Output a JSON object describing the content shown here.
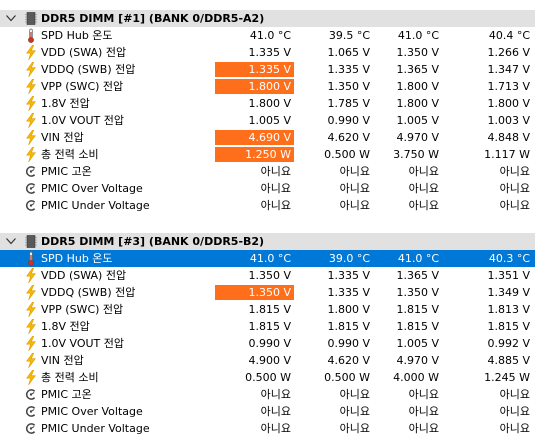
{
  "sections": [
    {
      "title": "DDR5 DIMM [#1] (BANK 0/DDR5-A2)",
      "rows": [
        {
          "icon": "thermometer-icon",
          "label": "SPD Hub 온도",
          "values": [
            "41.0 °C",
            "39.5 °C",
            "41.0 °C",
            "40.4 °C"
          ],
          "hl": []
        },
        {
          "icon": "lightning-icon",
          "label": "VDD (SWA) 전압",
          "values": [
            "1.335 V",
            "1.065 V",
            "1.350 V",
            "1.266 V"
          ],
          "hl": []
        },
        {
          "icon": "lightning-icon",
          "label": "VDDQ (SWB) 전압",
          "values": [
            "1.335 V",
            "1.335 V",
            "1.365 V",
            "1.347 V"
          ],
          "hl": [
            0
          ]
        },
        {
          "icon": "lightning-icon",
          "label": "VPP (SWC) 전압",
          "values": [
            "1.800 V",
            "1.350 V",
            "1.800 V",
            "1.713 V"
          ],
          "hl": [
            0
          ]
        },
        {
          "icon": "lightning-icon",
          "label": "1.8V 전압",
          "values": [
            "1.800 V",
            "1.785 V",
            "1.800 V",
            "1.800 V"
          ],
          "hl": []
        },
        {
          "icon": "lightning-icon",
          "label": "1.0V VOUT 전압",
          "values": [
            "1.005 V",
            "0.990 V",
            "1.005 V",
            "1.003 V"
          ],
          "hl": []
        },
        {
          "icon": "lightning-icon",
          "label": "VIN 전압",
          "values": [
            "4.690 V",
            "4.620 V",
            "4.970 V",
            "4.848 V"
          ],
          "hl": [
            0
          ]
        },
        {
          "icon": "lightning-icon",
          "label": "총 전력 소비",
          "values": [
            "1.250 W",
            "0.500 W",
            "3.750 W",
            "1.117 W"
          ],
          "hl": [
            0
          ]
        },
        {
          "icon": "status-icon",
          "label": "PMIC 고온",
          "values": [
            "아니요",
            "아니요",
            "아니요",
            "아니요"
          ],
          "hl": []
        },
        {
          "icon": "status-icon",
          "label": "PMIC Over Voltage",
          "values": [
            "아니요",
            "아니요",
            "아니요",
            "아니요"
          ],
          "hl": []
        },
        {
          "icon": "status-icon",
          "label": "PMIC Under Voltage",
          "values": [
            "아니요",
            "아니요",
            "아니요",
            "아니요"
          ],
          "hl": []
        }
      ]
    },
    {
      "title": "DDR5 DIMM [#3] (BANK 0/DDR5-B2)",
      "rows": [
        {
          "icon": "thermometer-icon",
          "label": "SPD Hub 온도",
          "values": [
            "41.0 °C",
            "39.0 °C",
            "41.0 °C",
            "40.3 °C"
          ],
          "hl": [],
          "selected": true
        },
        {
          "icon": "lightning-icon",
          "label": "VDD (SWA) 전압",
          "values": [
            "1.350 V",
            "1.335 V",
            "1.365 V",
            "1.351 V"
          ],
          "hl": []
        },
        {
          "icon": "lightning-icon",
          "label": "VDDQ (SWB) 전압",
          "values": [
            "1.350 V",
            "1.335 V",
            "1.350 V",
            "1.349 V"
          ],
          "hl": [
            0
          ]
        },
        {
          "icon": "lightning-icon",
          "label": "VPP (SWC) 전압",
          "values": [
            "1.815 V",
            "1.800 V",
            "1.815 V",
            "1.813 V"
          ],
          "hl": []
        },
        {
          "icon": "lightning-icon",
          "label": "1.8V 전압",
          "values": [
            "1.815 V",
            "1.815 V",
            "1.815 V",
            "1.815 V"
          ],
          "hl": []
        },
        {
          "icon": "lightning-icon",
          "label": "1.0V VOUT 전압",
          "values": [
            "0.990 V",
            "0.990 V",
            "1.005 V",
            "0.992 V"
          ],
          "hl": []
        },
        {
          "icon": "lightning-icon",
          "label": "VIN 전압",
          "values": [
            "4.900 V",
            "4.620 V",
            "4.970 V",
            "4.885 V"
          ],
          "hl": []
        },
        {
          "icon": "lightning-icon",
          "label": "총 전력 소비",
          "values": [
            "0.500 W",
            "0.500 W",
            "4.000 W",
            "1.245 W"
          ],
          "hl": []
        },
        {
          "icon": "status-icon",
          "label": "PMIC 고온",
          "values": [
            "아니요",
            "아니요",
            "아니요",
            "아니요"
          ],
          "hl": []
        },
        {
          "icon": "status-icon",
          "label": "PMIC Over Voltage",
          "values": [
            "아니요",
            "아니요",
            "아니요",
            "아니요"
          ],
          "hl": []
        },
        {
          "icon": "status-icon",
          "label": "PMIC Under Voltage",
          "values": [
            "아니요",
            "아니요",
            "아니요",
            "아니요"
          ],
          "hl": []
        }
      ]
    }
  ],
  "colors": {
    "header_bg": "#e1e1e1",
    "highlight": "#ff6e1a",
    "selected": "#0078d7",
    "lightning": "#f5b800",
    "thermometer": "#c0392b"
  }
}
